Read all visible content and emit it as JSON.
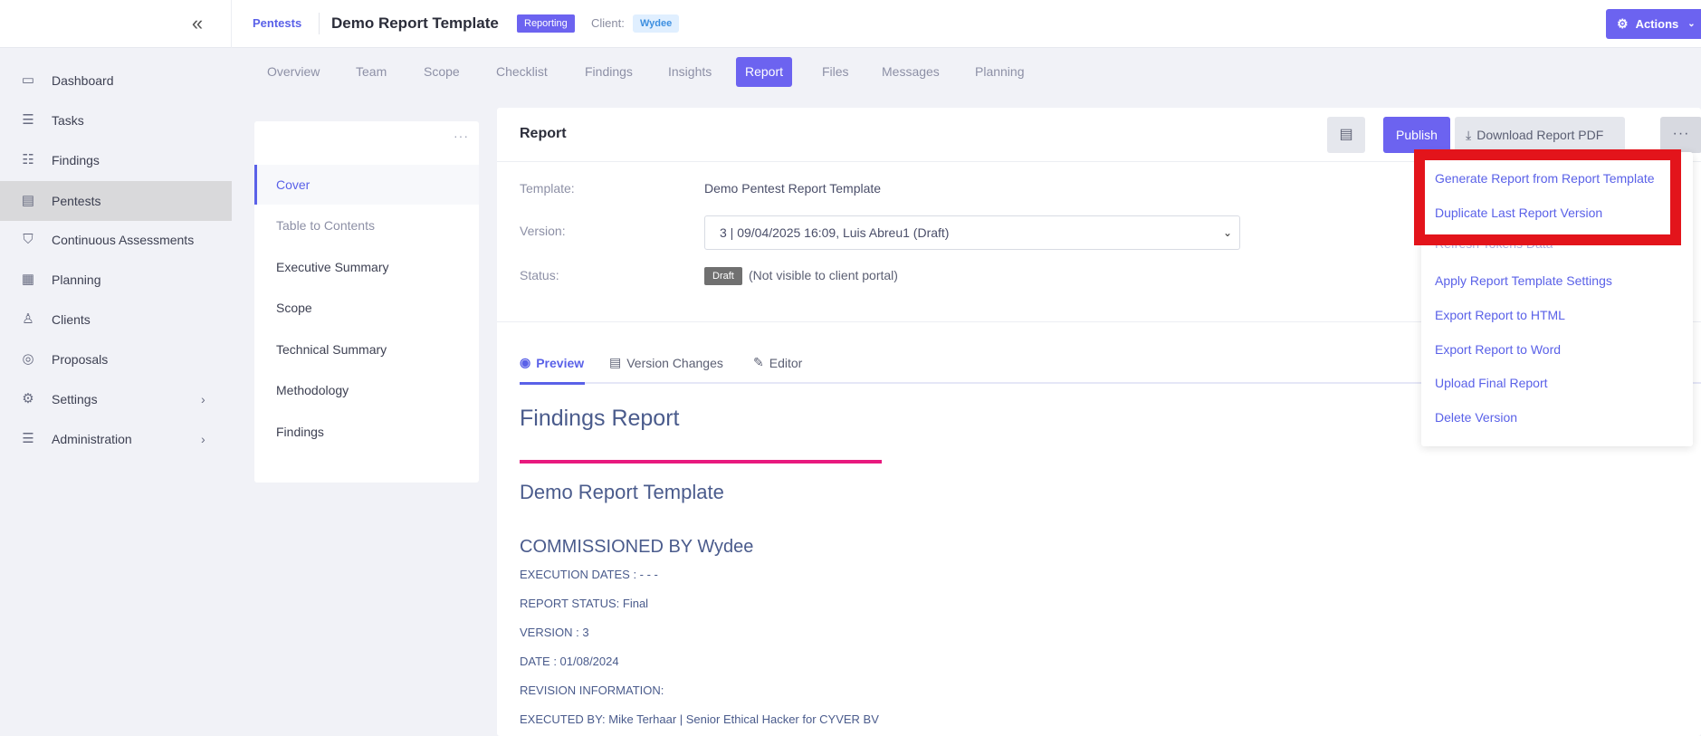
{
  "topbar": {
    "breadcrumb": "Pentests",
    "title": "Demo Report Template",
    "status_badge": "Reporting",
    "client_label": "Client:",
    "client_name": "Wydee",
    "actions_label": "Actions"
  },
  "sidebar": {
    "items": [
      {
        "label": "Dashboard",
        "icon": "dashboard-icon"
      },
      {
        "label": "Tasks",
        "icon": "tasks-icon"
      },
      {
        "label": "Findings",
        "icon": "findings-icon"
      },
      {
        "label": "Pentests",
        "icon": "pentests-icon",
        "active": true
      },
      {
        "label": "Continuous Assessments",
        "icon": "shield-icon"
      },
      {
        "label": "Planning",
        "icon": "calendar-icon"
      },
      {
        "label": "Clients",
        "icon": "clients-icon"
      },
      {
        "label": "Proposals",
        "icon": "proposals-icon"
      },
      {
        "label": "Settings",
        "icon": "gear-icon",
        "expandable": true
      },
      {
        "label": "Administration",
        "icon": "sliders-icon",
        "expandable": true
      }
    ]
  },
  "tabs": [
    "Overview",
    "Team",
    "Scope",
    "Checklist",
    "Findings",
    "Insights",
    "Report",
    "Files",
    "Messages",
    "Planning"
  ],
  "active_tab": "Report",
  "toc": {
    "items": [
      "Cover",
      "Table to Contents",
      "Executive Summary",
      "Scope",
      "Technical Summary",
      "Methodology",
      "Findings"
    ],
    "active": "Cover"
  },
  "report": {
    "title": "Report",
    "publish_label": "Publish",
    "download_label": "Download Report PDF",
    "template_label": "Template:",
    "template_value": "Demo Pentest Report Template",
    "version_label": "Version:",
    "version_value": "3 | 09/04/2025 16:09, Luis Abreu1 (Draft)",
    "status_label": "Status:",
    "status_badge": "Draft",
    "status_note": "(Not visible to client portal)",
    "subtabs": [
      "Preview",
      "Version Changes",
      "Editor"
    ],
    "active_subtab": "Preview"
  },
  "preview": {
    "h1": "Findings Report",
    "h2": "Demo Report Template",
    "h3": "COMMISSIONED BY Wydee",
    "lines": [
      "EXECUTION DATES : - - -",
      "REPORT STATUS: Final",
      "VERSION : 3",
      "DATE : 01/08/2024",
      "REVISION INFORMATION:",
      "EXECUTED BY: Mike Terhaar | Senior Ethical Hacker for CYVER BV"
    ]
  },
  "dropdown": {
    "items": [
      "Generate Report from Report Template",
      "Duplicate Last Report Version",
      "Refresh Tokens Data",
      "Apply Report Template Settings",
      "Export Report to HTML",
      "Export Report to Word",
      "Upload Final Report",
      "Delete Version"
    ]
  },
  "colors": {
    "accent": "#6c63f0",
    "link": "#5a61e8",
    "pink_rule": "#e8197e",
    "highlight": "#e3141b"
  }
}
